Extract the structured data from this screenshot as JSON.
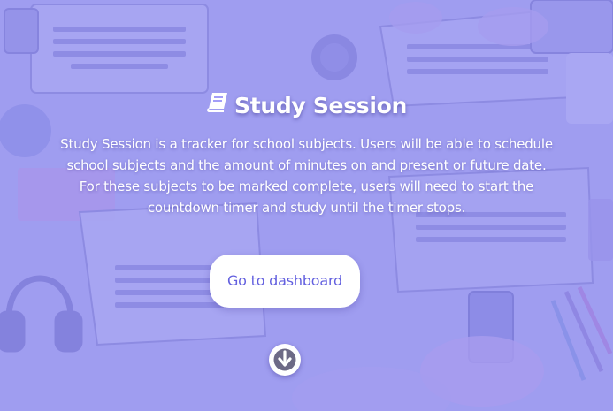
{
  "hero": {
    "title": "Study Session",
    "title_icon": "book-icon",
    "description": "Study Session is a tracker for school subjects. Users will be able to schedule school subjects and the amount of minutes on and present or future date. For these subjects to be marked complete, users will need to start the countdown timer and study until the timer stops.",
    "dashboard_button_label": "Go to dashboard",
    "scroll_icon": "arrow-down-circle-icon"
  },
  "colors": {
    "overlay": "#8c86f6",
    "button_text": "#6360df",
    "text": "#ffffff"
  }
}
